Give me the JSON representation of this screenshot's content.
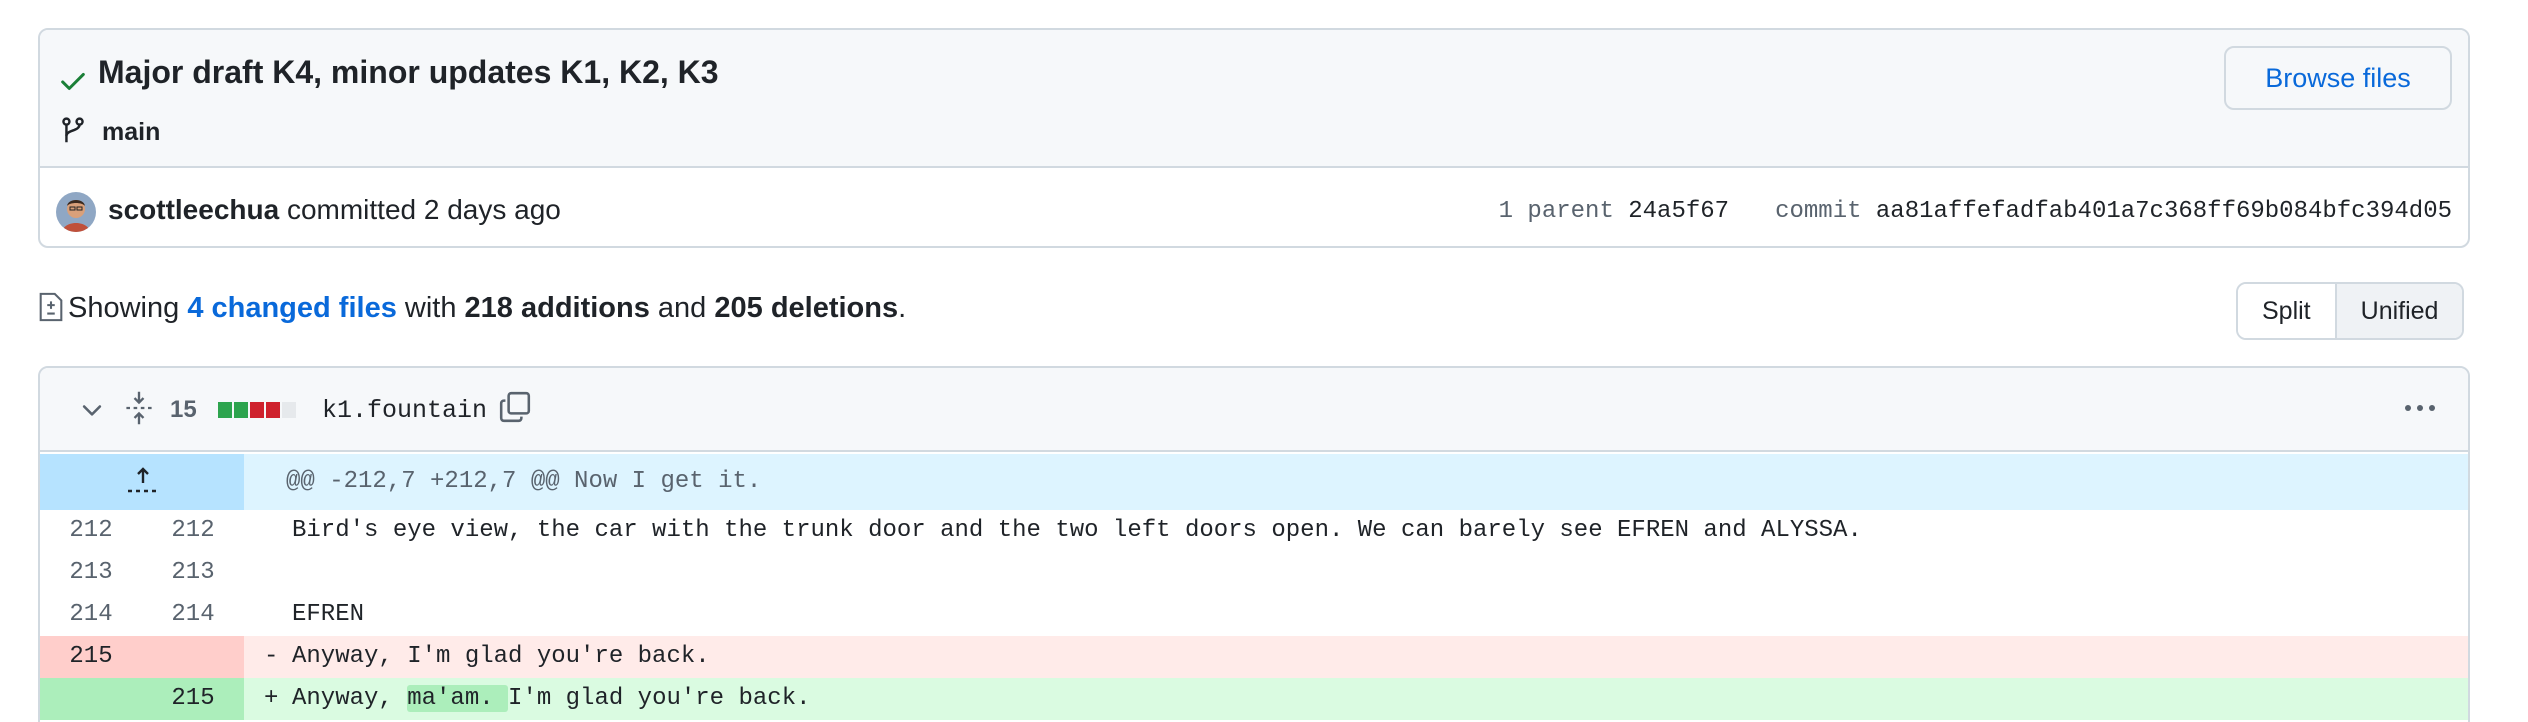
{
  "commit": {
    "title": "Major draft K4, minor updates K1, K2, K3",
    "branch": "main",
    "browse_files_label": "Browse files",
    "author": "scottleechua",
    "action_text": "committed 2 days ago",
    "parent_label": "1 parent",
    "parent_sha": "24a5f67",
    "commit_label": "commit",
    "commit_sha": "aa81affefadfab401a7c368ff69b084bfc394d05"
  },
  "summary": {
    "prefix": "Showing",
    "changed_files": "4 changed files",
    "with": "with",
    "additions": "218 additions",
    "and": "and",
    "deletions": "205 deletions",
    "period": "."
  },
  "view_toggle": {
    "split_label": "Split",
    "unified_label": "Unified",
    "selected": "Unified"
  },
  "file": {
    "change_count": "15",
    "filename": "k1.fountain",
    "diffstat_blocks": [
      "added",
      "added",
      "deleted",
      "deleted",
      "neutral"
    ],
    "hunk_header": "@@ -212,7 +212,7 @@ Now I get it.",
    "lines": [
      {
        "type": "context",
        "old": "212",
        "new": "212",
        "sign": " ",
        "text": "Bird's eye view, the car with the trunk door and the two left doors open. We can barely see EFREN and ALYSSA."
      },
      {
        "type": "context",
        "old": "213",
        "new": "213",
        "sign": " ",
        "text": ""
      },
      {
        "type": "context",
        "old": "214",
        "new": "214",
        "sign": " ",
        "text": "EFREN"
      },
      {
        "type": "del",
        "old": "215",
        "new": "",
        "sign": "-",
        "text": "Anyway, I'm glad you're back."
      },
      {
        "type": "add",
        "old": "",
        "new": "215",
        "sign": "+",
        "pre": "Anyway, ",
        "highlight": "ma'am. ",
        "post": "I'm glad you're back."
      }
    ]
  },
  "colors": {
    "accent": "#0969da",
    "success": "#1a7f37",
    "diff_add": "#dafbe1",
    "diff_del": "#ffebe9",
    "stat_add": "#2da44e",
    "stat_del": "#cf222e"
  }
}
